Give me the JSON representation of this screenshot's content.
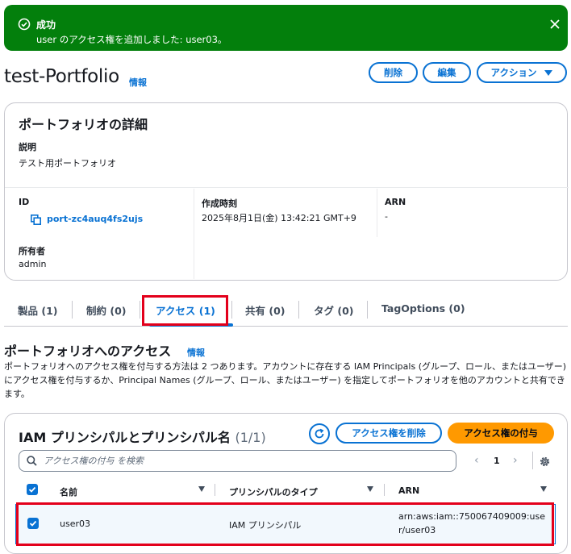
{
  "flash": {
    "title": "成功",
    "message": "user のアクセス権を追加しました: user03。"
  },
  "header": {
    "title": "test-Portfolio",
    "info": "情報",
    "buttons": {
      "delete": "削除",
      "edit": "編集",
      "actions": "アクション"
    }
  },
  "details": {
    "heading": "ポートフォリオの詳細",
    "description_label": "説明",
    "description_value": "テスト用ポートフォリオ",
    "id_label": "ID",
    "id_value": "port-zc4auq4fs2ujs",
    "owner_label": "所有者",
    "owner_value": "admin",
    "created_label": "作成時刻",
    "created_value": "2025年8月1日(金) 13:42:21 GMT+9",
    "arn_label": "ARN",
    "arn_value": "-"
  },
  "tabs": [
    "製品 (1)",
    "制約 (0)",
    "アクセス (1)",
    "共有 (0)",
    "タグ (0)",
    "TagOptions (0)"
  ],
  "access": {
    "title": "ポートフォリオへのアクセス",
    "info": "情報",
    "description": "ポートフォリオへのアクセス権を付与する方法は 2 つあります。アカウントに存在する IAM Principals (グループ、ロール、またはユーザー) にアクセス権を付与するか、Principal Names (グループ、ロール、またはユーザー) を指定してポートフォリオを他のアカウントと共有できます。"
  },
  "table": {
    "title": "IAM プリンシパルとプリンシパル名",
    "count": "(1/1)",
    "remove_button": "アクセス権を削除",
    "grant_button": "アクセス権の付与",
    "search_placeholder": "アクセス権の付与 を検索",
    "page": "1",
    "columns": [
      "名前",
      "プリンシパルのタイプ",
      "ARN"
    ],
    "rows": [
      {
        "name": "user03",
        "type": "IAM プリンシパル",
        "arn_line1": "arn:aws:iam::750067409009:use",
        "arn_line2": "r/user03"
      }
    ]
  },
  "colors": {
    "success": "#037f0c",
    "link": "#0972d3",
    "primary": "#ff9900",
    "highlight": "#e3001b"
  }
}
